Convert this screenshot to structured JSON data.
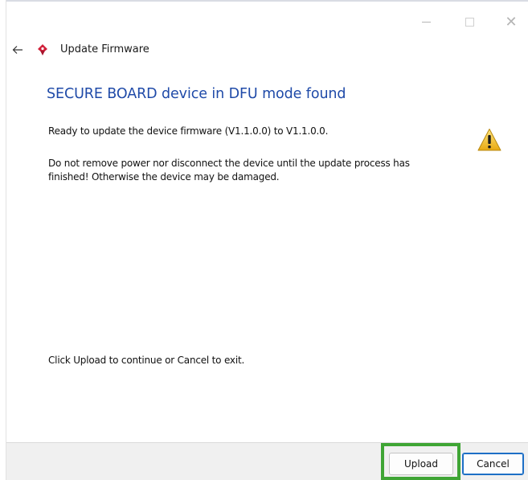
{
  "window": {
    "minimize_icon": "minimize-icon",
    "maximize_icon": "maximize-icon",
    "close_icon": "close-icon",
    "close_glyph": "✕"
  },
  "header": {
    "back_icon": "back-arrow-icon",
    "app_icon": "app-logo-icon",
    "title": "Update Firmware"
  },
  "main": {
    "heading": "SECURE BOARD device in DFU mode found",
    "ready_text": "Ready to update the device firmware (V1.1.0.0) to V1.1.0.0.",
    "warning_text": "Do not remove power nor disconnect the device until the update process has finished! Otherwise the device may be damaged.",
    "warning_icon": "warning-icon",
    "continue_text": "Click Upload to continue or Cancel to exit."
  },
  "footer": {
    "upload_label": "Upload",
    "cancel_label": "Cancel"
  },
  "colors": {
    "heading": "#1f4aa8",
    "highlight": "#3fa535",
    "default_button_border": "#1d6fc6",
    "app_icon": "#d1203a",
    "warning_fill": "#f2c12e"
  }
}
